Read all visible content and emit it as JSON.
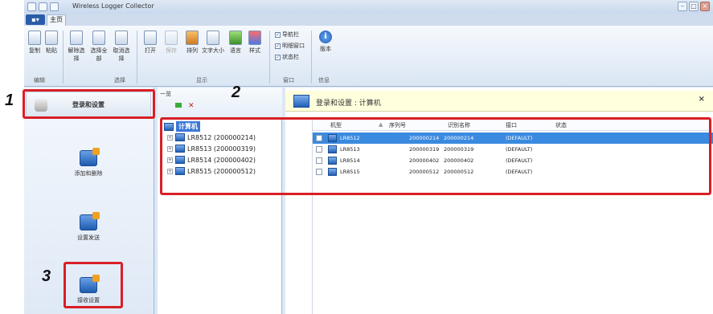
{
  "window": {
    "title": "Wireless Logger Collector",
    "buttons": [
      "minimize",
      "maximize",
      "close"
    ]
  },
  "tabs": {
    "app_menu": "",
    "home": "主页"
  },
  "ribbon": {
    "edit": {
      "cut": "复制",
      "paste": "粘贴",
      "group": "编辑"
    },
    "select": {
      "clear": "解除选择",
      "select_all": "选择全部",
      "deselect": "取消选择",
      "group": "选择"
    },
    "display": {
      "open": "打开",
      "save": "保存",
      "columns": "排列",
      "text_size": "文字大小",
      "language": "语言",
      "style": "样式",
      "group": "显示"
    },
    "window": {
      "nav_bar": "导航栏",
      "details_window": "明细窗口",
      "status_bar": "状态栏",
      "group": "窗口"
    },
    "info": {
      "version": "版本",
      "group": "信息"
    }
  },
  "nav": {
    "login": "登录和设置",
    "add_remove": "添加和删除",
    "send_settings": "设置发送",
    "receive_settings": "接收设置"
  },
  "tree": {
    "tab_label": "一览",
    "root": "计算机",
    "items": [
      "LR8512 (200000214)",
      "LR8513 (200000319)",
      "LR8514 (200000402)",
      "LR8515 (200000512)"
    ]
  },
  "content": {
    "header_title": "登录和设置 : 计算机",
    "columns": [
      "机型",
      "序列号",
      "识别名称",
      "接口",
      "状态"
    ],
    "rows": [
      {
        "model": "LR8512",
        "serial": "200000214",
        "name": "200000214",
        "interface": "(DEFAULT)",
        "status": "",
        "selected": true
      },
      {
        "model": "LR8513",
        "serial": "200000319",
        "name": "200000319",
        "interface": "(DEFAULT)",
        "status": "",
        "selected": false
      },
      {
        "model": "LR8514",
        "serial": "200000402",
        "name": "200000402",
        "interface": "(DEFAULT)",
        "status": "",
        "selected": false
      },
      {
        "model": "LR8515",
        "serial": "200000512",
        "name": "200000512",
        "interface": "(DEFAULT)",
        "status": "",
        "selected": false
      }
    ]
  },
  "callouts": {
    "one": "1",
    "two": "2",
    "three": "3"
  },
  "colors": {
    "callout": "#d81f26",
    "selected_row": "#3a8ae0",
    "header_bg": "#ffffdd"
  }
}
